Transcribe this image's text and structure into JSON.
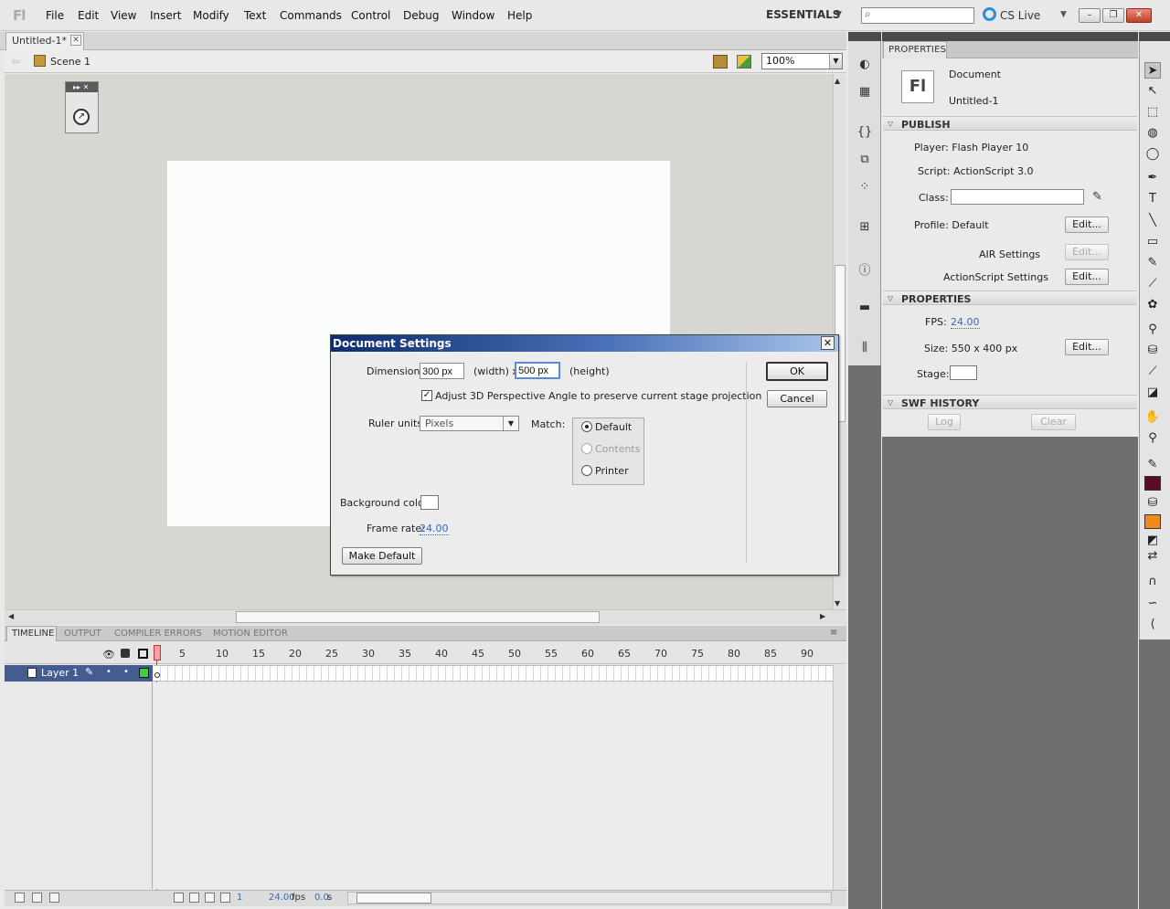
{
  "app": {
    "logo": "Fl",
    "menu": [
      "File",
      "Edit",
      "View",
      "Insert",
      "Modify",
      "Text",
      "Commands",
      "Control",
      "Debug",
      "Window",
      "Help"
    ],
    "workspace": "ESSENTIALS",
    "search_placeholder": "",
    "cs_live": "CS Live"
  },
  "document_tab": {
    "title": "Untitled-1*",
    "close": "✕"
  },
  "editbar": {
    "scene": "Scene 1",
    "zoom": "100%"
  },
  "timeline": {
    "tabs": [
      "TIMELINE",
      "OUTPUT",
      "COMPILER ERRORS",
      "MOTION EDITOR"
    ],
    "frame_numbers": [
      "5",
      "10",
      "15",
      "20",
      "25",
      "30",
      "35",
      "40",
      "45",
      "50",
      "55",
      "60",
      "65",
      "70",
      "75",
      "80",
      "85",
      "90"
    ],
    "layer_name": "Layer 1",
    "current_frame": "1",
    "fps_value": "24.00",
    "fps_unit": "fps",
    "time_value": "0.0",
    "time_unit": "s"
  },
  "properties": {
    "tab": "PROPERTIES",
    "doc_type": "Document",
    "doc_name": "Untitled-1",
    "thumb": "Fl",
    "publish": {
      "header": "PUBLISH",
      "player": "Player: Flash Player 10",
      "script": "Script: ActionScript 3.0",
      "class_label": "Class:",
      "profile": "Profile: Default",
      "edit": "Edit...",
      "air_settings": "AIR Settings",
      "as_settings": "ActionScript Settings"
    },
    "props": {
      "header": "PROPERTIES",
      "fps_label": "FPS:",
      "fps_value": "24.00",
      "size": "Size: 550 x 400 px",
      "stage_label": "Stage:"
    },
    "swf_history": {
      "header": "SWF HISTORY",
      "log": "Log",
      "clear": "Clear"
    }
  },
  "dialog": {
    "title": "Document Settings",
    "dimensions_label": "Dimensions:",
    "width_value": "300 px",
    "width_label": "(width) x",
    "height_value": "500 px",
    "height_label": "(height)",
    "adjust_3d": "Adjust 3D Perspective Angle to preserve current stage projection",
    "adjust_3d_checked": true,
    "ruler_label": "Ruler units:",
    "ruler_value": "Pixels",
    "match_label": "Match:",
    "match_options": [
      "Default",
      "Contents",
      "Printer"
    ],
    "match_selected": "Default",
    "bg_label": "Background color:",
    "frame_rate_label": "Frame rate:",
    "frame_rate_value": "24.00",
    "make_default": "Make Default",
    "ok": "OK",
    "cancel": "Cancel"
  },
  "colors": {
    "stroke": "#5d0d23",
    "fill": "#f08a1a",
    "layer_color": "#39d13f",
    "selection_blue": "#445c8f"
  }
}
